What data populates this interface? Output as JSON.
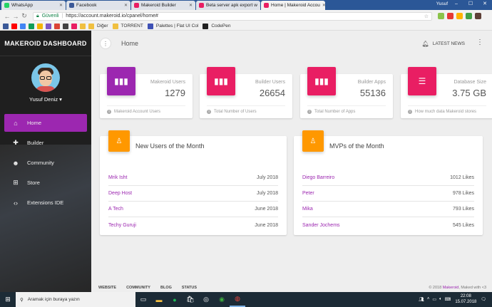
{
  "browser": {
    "tabs": [
      {
        "label": "WhatsApp",
        "color": "#25d366",
        "active": false
      },
      {
        "label": "Facebook",
        "color": "#3b5998",
        "active": false
      },
      {
        "label": "Makeroid Builder",
        "color": "#e91e63",
        "active": false
      },
      {
        "label": "Beta server apk export w",
        "color": "#e91e63",
        "active": false
      },
      {
        "label": "Home | Makeroid Accou",
        "color": "#e91e63",
        "active": true
      }
    ],
    "user": "Yusuf",
    "secure_label": "Güvenli",
    "url": "https://account.makeroid.io/cpanel/home#",
    "bookmarks": [
      {
        "label": "",
        "color": "#3b5998"
      },
      {
        "label": "",
        "color": "#ff0000"
      },
      {
        "label": "",
        "color": "#4285f4"
      },
      {
        "label": "",
        "color": "#0f9d58"
      },
      {
        "label": "",
        "color": "#f4b400"
      },
      {
        "label": "",
        "color": "#7e57c2"
      },
      {
        "label": "",
        "color": "#db4437"
      },
      {
        "label": "",
        "color": "#424242"
      },
      {
        "label": "",
        "color": "#e91e63"
      },
      {
        "label": "",
        "color": "#f0c040"
      },
      {
        "label": "Diğer",
        "color": "#f0c040"
      },
      {
        "label": "TORRENT",
        "color": "#f0c040"
      },
      {
        "label": "Palettes | Flat UI Col",
        "color": "#3f51b5"
      },
      {
        "label": "CodePen",
        "color": "#222222"
      }
    ]
  },
  "sidebar": {
    "brand": "MAKEROID DASHBOARD",
    "username": "Yusuf Deniz",
    "items": [
      {
        "label": "Home",
        "icon": "home-icon",
        "glyph": "⌂",
        "active": true
      },
      {
        "label": "Builder",
        "icon": "puzzle-icon",
        "glyph": "✚",
        "active": false
      },
      {
        "label": "Community",
        "icon": "people-icon",
        "glyph": "☻",
        "active": false
      },
      {
        "label": "Store",
        "icon": "cart-icon",
        "glyph": "⊞",
        "active": false
      },
      {
        "label": "Extensions IDE",
        "icon": "code-icon",
        "glyph": "‹›",
        "active": false
      }
    ]
  },
  "header": {
    "title": "Home",
    "latest_news": "LATEST NEWS"
  },
  "stats": [
    {
      "label": "Makeroid Users",
      "value": "1279",
      "footer": "Makeroid Account Users",
      "color": "#9c27b0",
      "glyph": "▮▮▮"
    },
    {
      "label": "Builder Users",
      "value": "26654",
      "footer": "Total Number of Users",
      "color": "#e91e63",
      "glyph": "▮▮▮"
    },
    {
      "label": "Builder Apps",
      "value": "55136",
      "footer": "Total Number of Apps",
      "color": "#e91e63",
      "glyph": "▮▮▮"
    },
    {
      "label": "Database Size",
      "value": "3.75 GB",
      "footer": "How much data Makeroid stores",
      "color": "#e91e63",
      "glyph": "☰"
    }
  ],
  "new_users": {
    "title": "New Users of the Month",
    "rows": [
      {
        "name": "Mrik Isht",
        "value": "July 2018"
      },
      {
        "name": "Deep Host",
        "value": "July 2018"
      },
      {
        "name": "A Tech",
        "value": "June 2018"
      },
      {
        "name": "Techy Guruji",
        "value": "June 2018"
      }
    ]
  },
  "mvps": {
    "title": "MVPs of the Month",
    "rows": [
      {
        "name": "Diego Barreiro",
        "value": "1012 Likes"
      },
      {
        "name": "Peter",
        "value": "978 Likes"
      },
      {
        "name": "Mika",
        "value": "793 Likes"
      },
      {
        "name": "Sander Jochems",
        "value": "545 Likes"
      }
    ]
  },
  "footer": {
    "links": [
      "WEBSITE",
      "COMMUNITY",
      "BLOG",
      "STATUS"
    ],
    "copyright_prefix": "© 2018",
    "brand": "Makeroid",
    "copyright_suffix": ", Maked with <3"
  },
  "taskbar": {
    "search_placeholder": "Aramak için buraya yazın",
    "time": "22:08",
    "date": "15.07.2018"
  },
  "colors": {
    "accent": "#9c27b0",
    "pink": "#e91e63",
    "orange": "#ff9800"
  }
}
